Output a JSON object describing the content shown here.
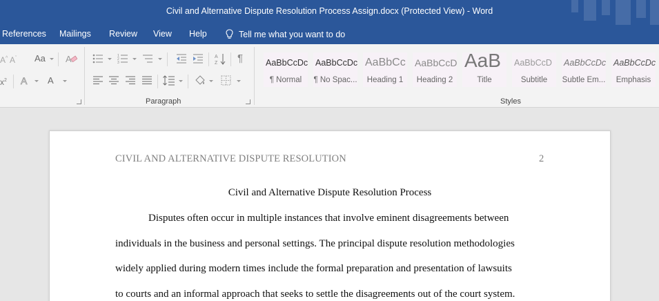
{
  "window": {
    "title": "Civil and Alternative Dispute Resolution Process Assign.docx (Protected View)  -  Word"
  },
  "menu": {
    "tabs": [
      "References",
      "Mailings",
      "Review",
      "View",
      "Help"
    ],
    "tell_me": "Tell me what you want to do"
  },
  "ribbon": {
    "font_group": {
      "icons": [
        "font-grow-icon",
        "change-case-icon",
        "clear-formatting-icon",
        "superscript-icon",
        "text-effects-icon",
        "font-color-icon"
      ]
    },
    "paragraph_group": {
      "label": "Paragraph",
      "icons": [
        "bullets-icon",
        "numbering-icon",
        "multilevel-list-icon",
        "decrease-indent-icon",
        "increase-indent-icon",
        "sort-icon",
        "show-marks-icon",
        "align-left-icon",
        "align-center-icon",
        "align-right-icon",
        "justify-icon",
        "line-spacing-icon",
        "shading-icon",
        "borders-icon"
      ]
    },
    "styles_group": {
      "label": "Styles",
      "items": [
        {
          "sample": "AaBbCcDc",
          "name": "¶ Normal"
        },
        {
          "sample": "AaBbCcDc",
          "name": "¶ No Spac..."
        },
        {
          "sample": "AaBbCc",
          "name": "Heading 1"
        },
        {
          "sample": "AaBbCcD",
          "name": "Heading 2"
        },
        {
          "sample": "AaB",
          "name": "Title"
        },
        {
          "sample": "AaBbCcD",
          "name": "Subtitle"
        },
        {
          "sample": "AaBbCcDc",
          "name": "Subtle Em..."
        },
        {
          "sample": "AaBbCcDc",
          "name": "Emphasis"
        }
      ]
    }
  },
  "document": {
    "running_head": "CIVIL AND ALTERNATIVE DISPUTE RESOLUTION",
    "page_number": "2",
    "title": "Civil and Alternative Dispute Resolution Process",
    "lines": [
      "Disputes often occur in multiple instances that involve eminent disagreements between",
      "individuals in the business and personal settings. The principal dispute resolution methodologies",
      "widely applied during modern times include the formal preparation and presentation of lawsuits",
      "to courts and an informal approach that seeks to settle the disagreements out of the court system."
    ]
  },
  "colors": {
    "titlebar": "#2b579a",
    "ribbon": "#f3f3f3",
    "workspace": "#e6e6e6",
    "page": "#ffffff",
    "running_head_text": "#7f7f7f"
  }
}
